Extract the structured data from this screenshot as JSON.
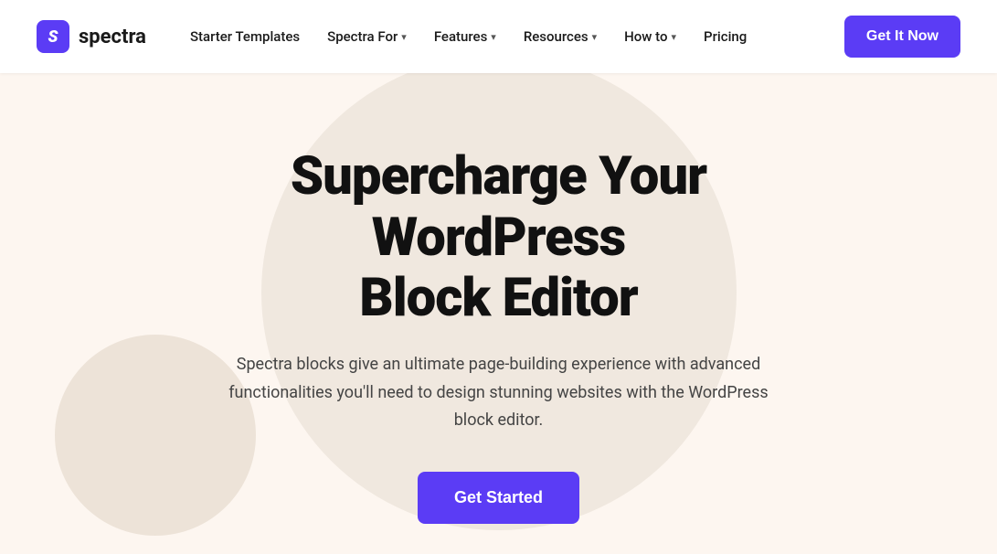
{
  "nav": {
    "logo": {
      "icon_letter": "S",
      "text": "spectra"
    },
    "links": [
      {
        "id": "starter-templates",
        "label": "Starter Templates",
        "has_dropdown": false
      },
      {
        "id": "spectra-for",
        "label": "Spectra For",
        "has_dropdown": true
      },
      {
        "id": "features",
        "label": "Features",
        "has_dropdown": true
      },
      {
        "id": "resources",
        "label": "Resources",
        "has_dropdown": true
      },
      {
        "id": "how-to",
        "label": "How to",
        "has_dropdown": true
      },
      {
        "id": "pricing",
        "label": "Pricing",
        "has_dropdown": false
      }
    ],
    "cta_label": "Get It Now"
  },
  "hero": {
    "title_line1": "Supercharge Your WordPress",
    "title_line2": "Block Editor",
    "subtitle": "Spectra blocks give an ultimate page-building experience with advanced functionalities you'll need to design stunning websites with the WordPress block editor.",
    "cta_label": "Get Started"
  },
  "colors": {
    "accent": "#5b3cf5",
    "bg": "#fdf6f0",
    "circle_large": "#f0e8df",
    "circle_small": "#ede3d8",
    "text_dark": "#111111",
    "text_muted": "#444444"
  }
}
